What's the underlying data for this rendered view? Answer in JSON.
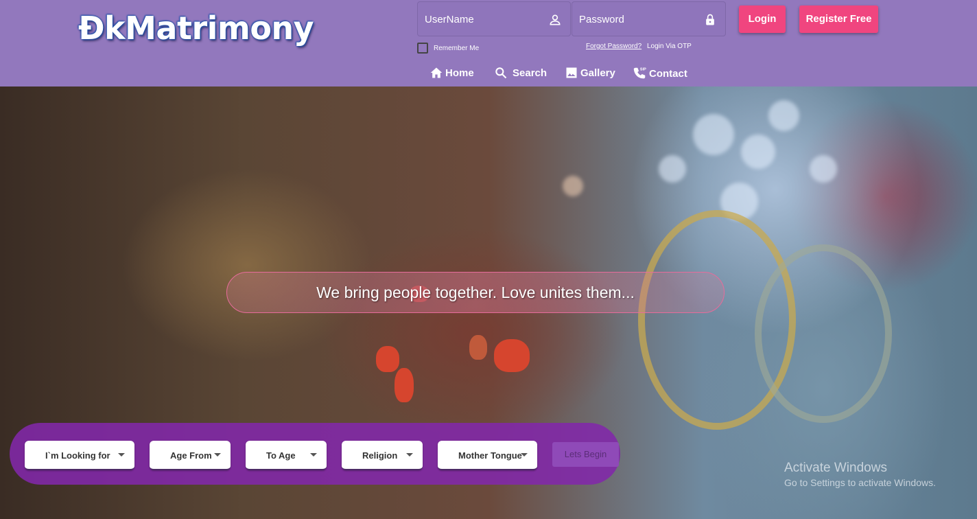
{
  "brand": {
    "logo": "ĐkMatrimony"
  },
  "login": {
    "username_placeholder": "UserName",
    "password_placeholder": "Password",
    "login_button": "Login",
    "register_button": "Register Free",
    "remember_me": "Remember Me",
    "forgot_password": "Forgot Password?",
    "login_via_otp": "Login Via OTP"
  },
  "nav": [
    {
      "label": "Home",
      "icon": "home-icon"
    },
    {
      "label": "Search",
      "icon": "search-icon"
    },
    {
      "label": "Gallery",
      "icon": "image-icon"
    },
    {
      "label": "Contact",
      "icon": "phone-icon"
    }
  ],
  "hero": {
    "tagline": "We bring people together. Love unites them..."
  },
  "search_bar": {
    "looking_for": "I`m Looking for",
    "age_from": "Age From",
    "to_age": "To Age",
    "religion": "Religion",
    "mother_tongue": "Mother Tongue",
    "submit": "Lets Begin"
  },
  "watermark": {
    "title": "Activate Windows",
    "subtitle": "Go to Settings to activate Windows."
  },
  "colors": {
    "header_bg": "#9278bd",
    "accent_pink": "#f0457f",
    "panel_purple": "#8228aa"
  }
}
